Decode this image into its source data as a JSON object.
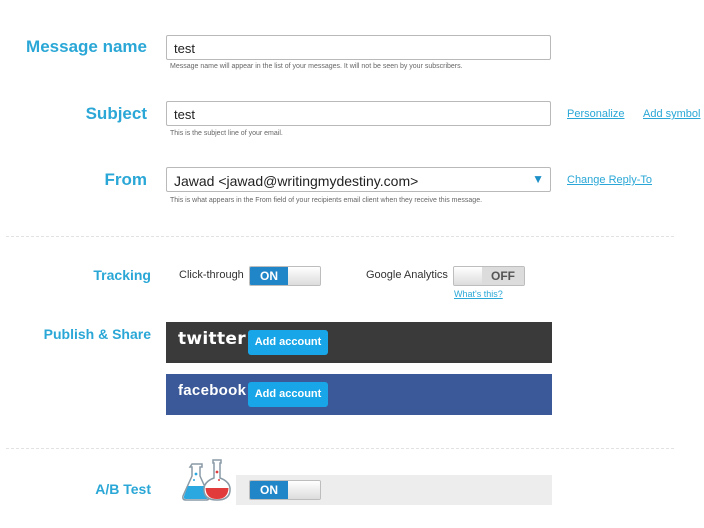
{
  "message_name": {
    "label": "Message name",
    "value": "test",
    "hint": "Message name will appear in the list of your messages. It will not be seen by your subscribers."
  },
  "subject": {
    "label": "Subject",
    "value": "test",
    "hint": "This is the subject line of your email.",
    "personalize_link": "Personalize",
    "add_symbol_link": "Add symbol"
  },
  "from": {
    "label": "From",
    "value": "Jawad <jawad@writingmydestiny.com>",
    "hint": "This is what appears in the From field of your recipients email client when they receive this message.",
    "change_reply_link": "Change Reply-To",
    "caret_icon": "triangle-down"
  },
  "tracking": {
    "label": "Tracking",
    "click_through_label": "Click-through",
    "click_through_state": "ON",
    "google_analytics_label": "Google Analytics",
    "google_analytics_state": "OFF",
    "whats_this_link": "What's this?"
  },
  "publish": {
    "label": "Publish & Share",
    "twitter_brand": "twitter",
    "twitter_button": "Add account",
    "twitter_color": "#3a3a3a",
    "facebook_brand": "facebook",
    "facebook_button": "Add account",
    "facebook_color": "#3b5998"
  },
  "ab_test": {
    "label": "A/B Test",
    "state": "ON",
    "icon": "flasks-icon"
  },
  "colors": {
    "accent": "#2aa7d6",
    "toggle_on": "#2186c8",
    "button": "#19a6e8"
  }
}
